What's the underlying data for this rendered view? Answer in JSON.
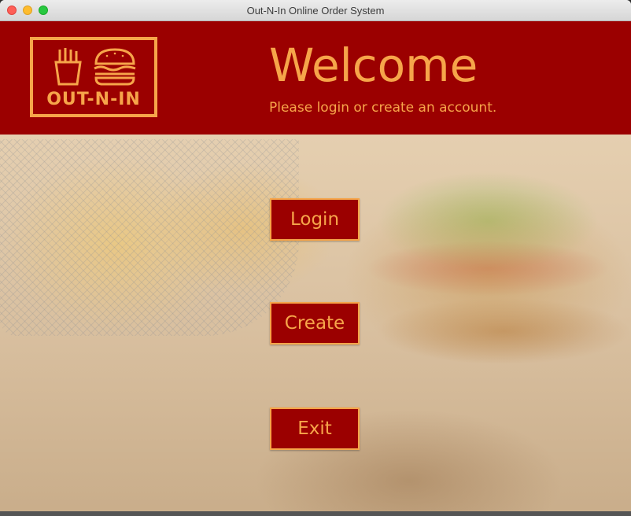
{
  "window": {
    "title": "Out-N-In Online Order System"
  },
  "header": {
    "logo_text": "OUT-N-IN",
    "logo_icons": [
      "fries-icon",
      "burger-icon"
    ],
    "welcome": "Welcome",
    "subtitle": "Please login or create an account."
  },
  "buttons": {
    "login": "Login",
    "create": "Create",
    "exit": "Exit"
  },
  "colors": {
    "header_bg": "#9b0000",
    "accent": "#f6a54a",
    "button_bg": "#9b0000"
  }
}
